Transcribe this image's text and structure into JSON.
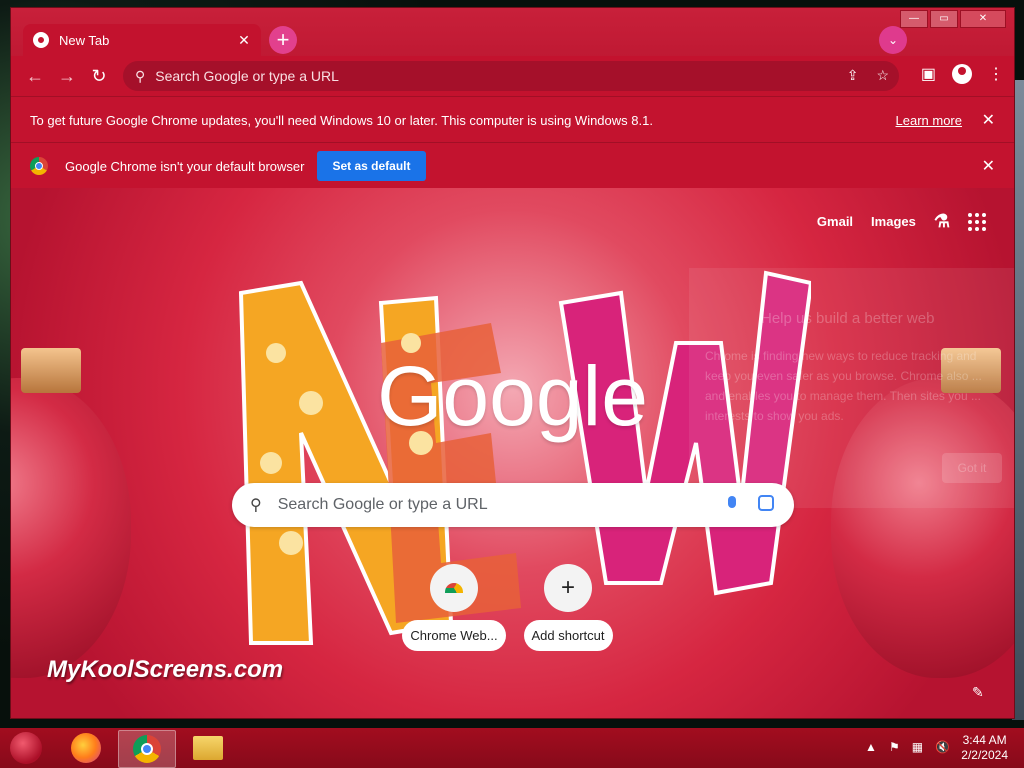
{
  "window": {
    "tab_title": "New Tab",
    "tab_close": "✕",
    "new_tab": "+",
    "tab_search": "⌄",
    "controls": {
      "minimize": "—",
      "maximize": "▭",
      "close": "✕"
    }
  },
  "toolbar": {
    "back": "←",
    "forward": "→",
    "reload": "↻",
    "omnibox_placeholder": "Search Google or type a URL"
  },
  "infobars": {
    "update_message": "To get future Google Chrome updates, you'll need Windows 10 or later. This computer is using Windows 8.1.",
    "learn_more": "Learn more",
    "default_message": "Google Chrome isn't your default browser",
    "set_default": "Set as default",
    "close": "✕"
  },
  "ntp": {
    "gmail": "Gmail",
    "images": "Images",
    "logo": "Google",
    "search_placeholder": "Search Google or type a URL",
    "shortcuts": [
      {
        "label": "Chrome Web...",
        "icon": "chrome-web-store-icon"
      },
      {
        "label": "Add shortcut",
        "icon": "plus-icon",
        "glyph": "+"
      }
    ],
    "watermark": "MyKoolScreens.com",
    "promo": {
      "title": "Help us build a better web",
      "body": "Chrome is finding new ways to reduce tracking and keep you even safer as you browse. Chrome also ... and enables you to manage them. Then sites you ... interests to show you ads.",
      "button": "Got it"
    }
  },
  "taskbar": {
    "time": "3:44 AM",
    "date": "2/2/2024"
  },
  "colors": {
    "theme_red": "#c3122e",
    "button_blue": "#1a73e8"
  }
}
